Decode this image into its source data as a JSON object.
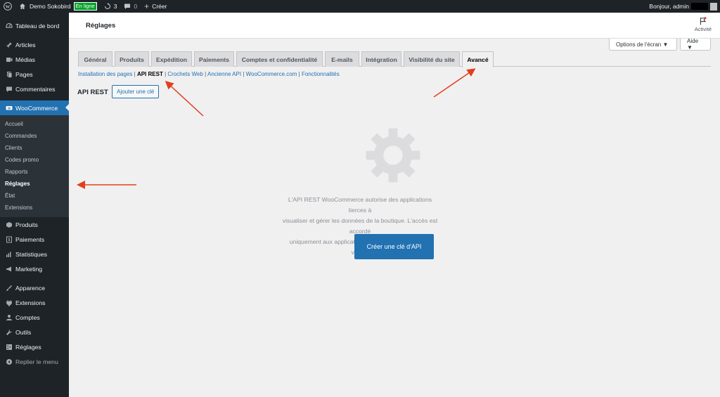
{
  "admin_bar": {
    "site_name": "Demo Sokobird",
    "status_badge": "En ligne",
    "updates_count": "3",
    "comments_count": "0",
    "new_label": "Créer",
    "greeting": "Bonjour, admin"
  },
  "sidebar": {
    "items_top": [
      {
        "label": "Tableau de bord",
        "icon": "dashboard-icon"
      },
      {
        "label": "Articles",
        "icon": "pin-icon"
      },
      {
        "label": "Médias",
        "icon": "media-icon"
      },
      {
        "label": "Pages",
        "icon": "pages-icon"
      },
      {
        "label": "Commentaires",
        "icon": "comments-icon"
      }
    ],
    "woocommerce": "WooCommerce",
    "submenu": [
      "Accueil",
      "Commandes",
      "Clients",
      "Codes promo",
      "Rapports",
      "Réglages",
      "État",
      "Extensions"
    ],
    "items_bottom": [
      {
        "label": "Produits",
        "icon": "products-icon"
      },
      {
        "label": "Paiements",
        "icon": "payments-icon"
      },
      {
        "label": "Statistiques",
        "icon": "stats-icon"
      },
      {
        "label": "Marketing",
        "icon": "megaphone-icon"
      },
      {
        "label": "Apparence",
        "icon": "brush-icon"
      },
      {
        "label": "Extensions",
        "icon": "plugin-icon"
      },
      {
        "label": "Comptes",
        "icon": "users-icon"
      },
      {
        "label": "Outils",
        "icon": "wrench-icon"
      },
      {
        "label": "Réglages",
        "icon": "settings-icon"
      }
    ],
    "collapse": "Replier le menu"
  },
  "header": {
    "title": "Réglages",
    "activity": "Activité"
  },
  "screen_options": {
    "options": "Options de l'écran ▼",
    "help": "Aide ▼"
  },
  "tabs": [
    "Général",
    "Produits",
    "Expédition",
    "Paiements",
    "Comptes et confidentialité",
    "E-mails",
    "Intégration",
    "Visibilité du site",
    "Avancé"
  ],
  "sublinks": [
    "Installation des pages",
    "API REST",
    "Crochets Web",
    "Ancienne API",
    "WooCommerce.com",
    "Fonctionnalités"
  ],
  "section": {
    "title": "API REST",
    "add_key": "Ajouter une clé"
  },
  "empty_state": {
    "line1": "L'API REST WooCommerce autorise des applications tierces à",
    "line2": "visualiser et gérer les données de la boutique. L'accès est accordé",
    "line3": "uniquement aux applications disposant d'une clé API valide.",
    "button": "Créer une clé d'API"
  },
  "colors": {
    "admin_dark": "#1d2327",
    "accent_blue": "#2271b1",
    "annotation_red": "#e2401c"
  }
}
